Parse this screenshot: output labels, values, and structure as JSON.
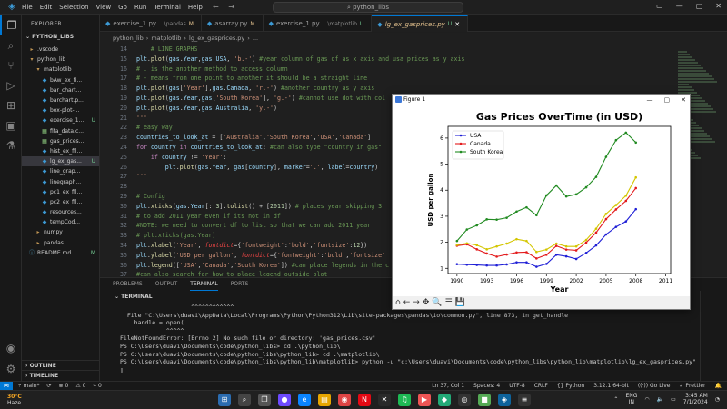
{
  "titlebar": {
    "menu": [
      "File",
      "Edit",
      "Selection",
      "View",
      "Go",
      "Run",
      "Terminal",
      "Help"
    ],
    "search_text": "python_libs",
    "nav_back": "←",
    "nav_fwd": "→"
  },
  "sidebar": {
    "header": "EXPLORER",
    "root": "PYTHON_LIBS",
    "items": [
      {
        "label": ".vscode",
        "kind": "folder",
        "indent": 1,
        "badge": ""
      },
      {
        "label": "python_lib",
        "kind": "folder-open",
        "indent": 1,
        "badge": ""
      },
      {
        "label": "matplotlib",
        "kind": "folder-open",
        "indent": 2,
        "badge": ""
      },
      {
        "label": "bAw_ex_fi...",
        "kind": "py",
        "indent": 3,
        "badge": ""
      },
      {
        "label": "bar_chart...",
        "kind": "py",
        "indent": 3,
        "badge": ""
      },
      {
        "label": "barchart.p...",
        "kind": "py",
        "indent": 3,
        "badge": ""
      },
      {
        "label": "box-plot-...",
        "kind": "py",
        "indent": 3,
        "badge": ""
      },
      {
        "label": "exercise_1...",
        "kind": "py",
        "indent": 3,
        "badge": "U"
      },
      {
        "label": "fifa_data.c...",
        "kind": "csv",
        "indent": 3,
        "badge": ""
      },
      {
        "label": "gas_prices...",
        "kind": "csv",
        "indent": 3,
        "badge": ""
      },
      {
        "label": "hist_ex_fil...",
        "kind": "py",
        "indent": 3,
        "badge": ""
      },
      {
        "label": "lg_ex_gas...",
        "kind": "py",
        "indent": 3,
        "badge": "U"
      },
      {
        "label": "line_grap...",
        "kind": "py",
        "indent": 3,
        "badge": ""
      },
      {
        "label": "linegraph...",
        "kind": "py",
        "indent": 3,
        "badge": ""
      },
      {
        "label": "pc1_ex_fil...",
        "kind": "py",
        "indent": 3,
        "badge": ""
      },
      {
        "label": "pc2_ex_fil...",
        "kind": "py",
        "indent": 3,
        "badge": ""
      },
      {
        "label": "resources...",
        "kind": "py",
        "indent": 3,
        "badge": ""
      },
      {
        "label": "tempCod...",
        "kind": "py",
        "indent": 3,
        "badge": ""
      },
      {
        "label": "numpy",
        "kind": "folder",
        "indent": 2,
        "badge": ""
      },
      {
        "label": "pandas",
        "kind": "folder",
        "indent": 2,
        "badge": ""
      },
      {
        "label": "README.md",
        "kind": "md",
        "indent": 1,
        "badge": "M"
      }
    ],
    "outline": "OUTLINE",
    "timeline": "TIMELINE"
  },
  "tabs": [
    {
      "name": "exercise_1.py",
      "desc": "...\\pandas",
      "badge": "M",
      "active": false
    },
    {
      "name": "asarray.py",
      "desc": "",
      "badge": "M",
      "active": false
    },
    {
      "name": "exercise_1.py",
      "desc": "...\\matplotlib",
      "badge": "U",
      "active": false
    },
    {
      "name": "lg_ex_gasprices.py",
      "desc": "",
      "badge": "U",
      "active": true
    }
  ],
  "breadcrumb": [
    "python_lib",
    "matplotlib",
    "lg_ex_gasprices.py",
    "..."
  ],
  "code_lines": [
    {
      "n": "14",
      "html": "<span class='cm'>    # LINE GRAPHS</span>"
    },
    {
      "n": "15",
      "html": "<span class='vr'>plt</span>.<span class='fn'>plot</span>(<span class='vr'>gas</span>.<span class='vr'>Year</span>,<span class='vr'>gas</span>.<span class='vr'>USA</span>, <span class='st'>'b.-'</span>) <span class='cm'>#year column of gas df as x axis and usa prices as y axis</span>"
    },
    {
      "n": "16",
      "html": "<span class='cm'># . is the another method to access column</span>"
    },
    {
      "n": "17",
      "html": "<span class='cm'># - means from one point to another it should be a straight line</span>"
    },
    {
      "n": "18",
      "html": "<span class='vr'>plt</span>.<span class='fn'>plot</span>(<span class='vr'>gas</span>[<span class='st'>'Year'</span>],<span class='vr'>gas</span>.<span class='vr'>Canada</span>, <span class='st'>'r.-'</span>) <span class='cm'>#another country as y axis</span>"
    },
    {
      "n": "19",
      "html": "<span class='vr'>plt</span>.<span class='fn'>plot</span>(<span class='vr'>gas</span>.<span class='vr'>Year</span>,<span class='vr'>gas</span>[<span class='st'>'South Korea'</span>], <span class='st'>'g.-'</span>) <span class='cm'>#cannot use dot with col</span>"
    },
    {
      "n": "20",
      "html": "<span class='vr'>plt</span>.<span class='fn'>plot</span>(<span class='vr'>gas</span>.<span class='vr'>Year</span>,<span class='vr'>gas</span>.<span class='vr'>Australia</span>, <span class='st'>'y.-'</span>)"
    },
    {
      "n": "21",
      "html": "<span class='st'>'''</span>"
    },
    {
      "n": "22",
      "html": "<span class='cm'># easy way</span>"
    },
    {
      "n": "23",
      "html": "<span class='vr'>countries_to_look_at</span> = [<span class='st'>'Australia'</span>,<span class='st'>'South Korea'</span>,<span class='st'>'USA'</span>,<span class='st'>'Canada'</span>]"
    },
    {
      "n": "24",
      "html": "<span class='kw'>for</span> <span class='vr'>country</span> <span class='kw'>in</span> <span class='vr'>countries_to_look_at</span>: <span class='cm'>#can also type \"country in gas\"</span>"
    },
    {
      "n": "25",
      "html": "    <span class='kw'>if</span> <span class='vr'>country</span> != <span class='st'>'Year'</span>:"
    },
    {
      "n": "26",
      "html": "        <span class='vr'>plt</span>.<span class='fn'>plot</span>(<span class='vr'>gas</span>.<span class='vr'>Year</span>, <span class='vr'>gas</span>[<span class='vr'>country</span>], <span class='vr'>marker</span>=<span class='st'>'.'</span>, <span class='vr'>label</span>=<span class='vr'>country</span>)"
    },
    {
      "n": "27",
      "html": "<span class='st'>'''</span>"
    },
    {
      "n": "28",
      "html": ""
    },
    {
      "n": "29",
      "html": "<span class='cm'># Config</span>"
    },
    {
      "n": "30",
      "html": "<span class='vr'>plt</span>.<span class='fn'>xticks</span>(<span class='vr'>gas</span>.<span class='vr'>Year</span>[::<span class='nm'>3</span>].<span class='fn'>tolist</span>() + [<span class='nm'>2011</span>]) <span class='cm'># places year skipping 3</span>"
    },
    {
      "n": "31",
      "html": "<span class='cm'># to add 2011 year even if its not in df</span>"
    },
    {
      "n": "32",
      "html": "<span class='cm'>#NOTE: we need to convert df to list so that we can add 2011 year</span>"
    },
    {
      "n": "33",
      "html": "<span class='cm'># plt.xticks(gas.Year)</span>"
    },
    {
      "n": "34",
      "html": "<span class='vr'>plt</span>.<span class='fn'>xlabel</span>(<span class='st'>'Year'</span>, <span class='pr'>fontdict</span>={<span class='st'>'fontweight'</span>:<span class='st'>'bold'</span>,<span class='st'>'fontsize'</span>:<span class='nm'>12</span>})"
    },
    {
      "n": "35",
      "html": "<span class='vr'>plt</span>.<span class='fn'>ylabel</span>(<span class='st'>'USD per gallon'</span>, <span class='pr'>fontdict</span>={<span class='st'>'fontweight'</span>:<span class='st'>'bold'</span>,<span class='st'>'fontsize'</span>"
    },
    {
      "n": "36",
      "html": "<span class='vr'>plt</span>.<span class='fn'>legend</span>([<span class='st'>'USA'</span>,<span class='st'>'Canada'</span>,<span class='st'>'South Korea'</span>]) <span class='cm'>#can place legends in the c</span>"
    },
    {
      "n": "37",
      "html": "<span class='cm'>#can also search for how to place legend outside plot</span>"
    }
  ],
  "figure": {
    "window_title": "Figure 1",
    "toolbar_icons": [
      "⌂",
      "←",
      "→",
      "✥",
      "🔍",
      "☰",
      "💾"
    ]
  },
  "chart_data": {
    "type": "line",
    "title": "Gas Prices OverTime (in USD)",
    "xlabel": "Year",
    "ylabel": "USD per gallon",
    "x": [
      1990,
      1991,
      1992,
      1993,
      1994,
      1995,
      1996,
      1997,
      1998,
      1999,
      2000,
      2001,
      2002,
      2003,
      2004,
      2005,
      2006,
      2007,
      2008
    ],
    "xticks": [
      1990,
      1993,
      1996,
      1999,
      2002,
      2005,
      2008,
      2011
    ],
    "yticks": [
      1,
      2,
      3,
      4,
      5,
      6
    ],
    "xlim": [
      1989.1,
      2011.5
    ],
    "ylim": [
      0.8,
      6.45
    ],
    "grid": false,
    "legend_position": "top-left",
    "series": [
      {
        "name": "USA",
        "color": "#1f1fd6",
        "values": [
          1.16,
          1.14,
          1.13,
          1.11,
          1.11,
          1.15,
          1.23,
          1.23,
          1.06,
          1.17,
          1.52,
          1.46,
          1.36,
          1.59,
          1.88,
          2.3,
          2.59,
          2.8,
          3.27
        ]
      },
      {
        "name": "Canada",
        "color": "#e31a1c",
        "values": [
          1.87,
          1.92,
          1.73,
          1.57,
          1.45,
          1.53,
          1.61,
          1.62,
          1.38,
          1.52,
          1.86,
          1.72,
          1.69,
          1.99,
          2.37,
          2.89,
          3.26,
          3.59,
          4.08
        ]
      },
      {
        "name": "South Korea",
        "color": "#228b22",
        "values": [
          2.05,
          2.49,
          2.65,
          2.88,
          2.87,
          2.94,
          3.18,
          3.34,
          3.04,
          3.8,
          4.18,
          3.76,
          3.84,
          4.11,
          4.51,
          5.28,
          5.92,
          6.21,
          5.83
        ]
      },
      {
        "name": "",
        "color": "#d4c600",
        "values": [
          1.9,
          1.96,
          1.89,
          1.73,
          1.84,
          1.95,
          2.12,
          2.05,
          1.63,
          1.72,
          1.95,
          1.84,
          1.84,
          2.09,
          2.52,
          3.09,
          3.43,
          3.79,
          4.49
        ]
      }
    ]
  },
  "panel": {
    "tabs": [
      "PROBLEMS",
      "OUTPUT",
      "TERMINAL",
      "PORTS"
    ],
    "active": "TERMINAL",
    "terminal_header": "TERMINAL",
    "lines": [
      "                    ^^^^^^^^^^^^",
      "  File \"C:\\Users\\duavi\\AppData\\Local\\Programs\\Python\\Python312\\Lib\\site-packages\\pandas\\io\\common.py\", line 873, in get_handle",
      "    handle = open(",
      "             ^^^^^",
      "FileNotFoundError: [Errno 2] No such file or directory: 'gas_prices.csv'",
      "PS C:\\Users\\duavi\\Documents\\code\\python_libs> cd .\\python_lib\\",
      "PS C:\\Users\\duavi\\Documents\\code\\python_libs\\python_lib> cd .\\matplotlib\\",
      "PS C:\\Users\\duavi\\Documents\\code\\python_libs\\python_lib\\matplotlib> python -u \"c:\\Users\\duavi\\Documents\\code\\python_libs\\python_lib\\matplotlib\\lg_ex_gasprices.py\"",
      "▯"
    ]
  },
  "status": {
    "branch": "main*",
    "sync": "⟳",
    "errors": "⊗ 0",
    "warnings": "⚠ 0",
    "ports": "⌁ 0",
    "position": "Ln 37, Col 1",
    "spaces": "Spaces: 4",
    "encoding": "UTF-8",
    "eol": "CRLF",
    "language": "{} Python",
    "interpreter": "3.12.1 64-bit",
    "golive": "((·)) Go Live",
    "prettier": "✓ Prettier",
    "bell": "🔔"
  },
  "taskbar": {
    "temp": "30°C",
    "weather": "Haze",
    "lang": "ENG",
    "region": "IN",
    "time": "3:45 AM",
    "date": "7/1/2024"
  },
  "colors": {
    "accent": "#0078d4",
    "editor_bg": "#1f1f1f",
    "sidebar_bg": "#181818"
  }
}
